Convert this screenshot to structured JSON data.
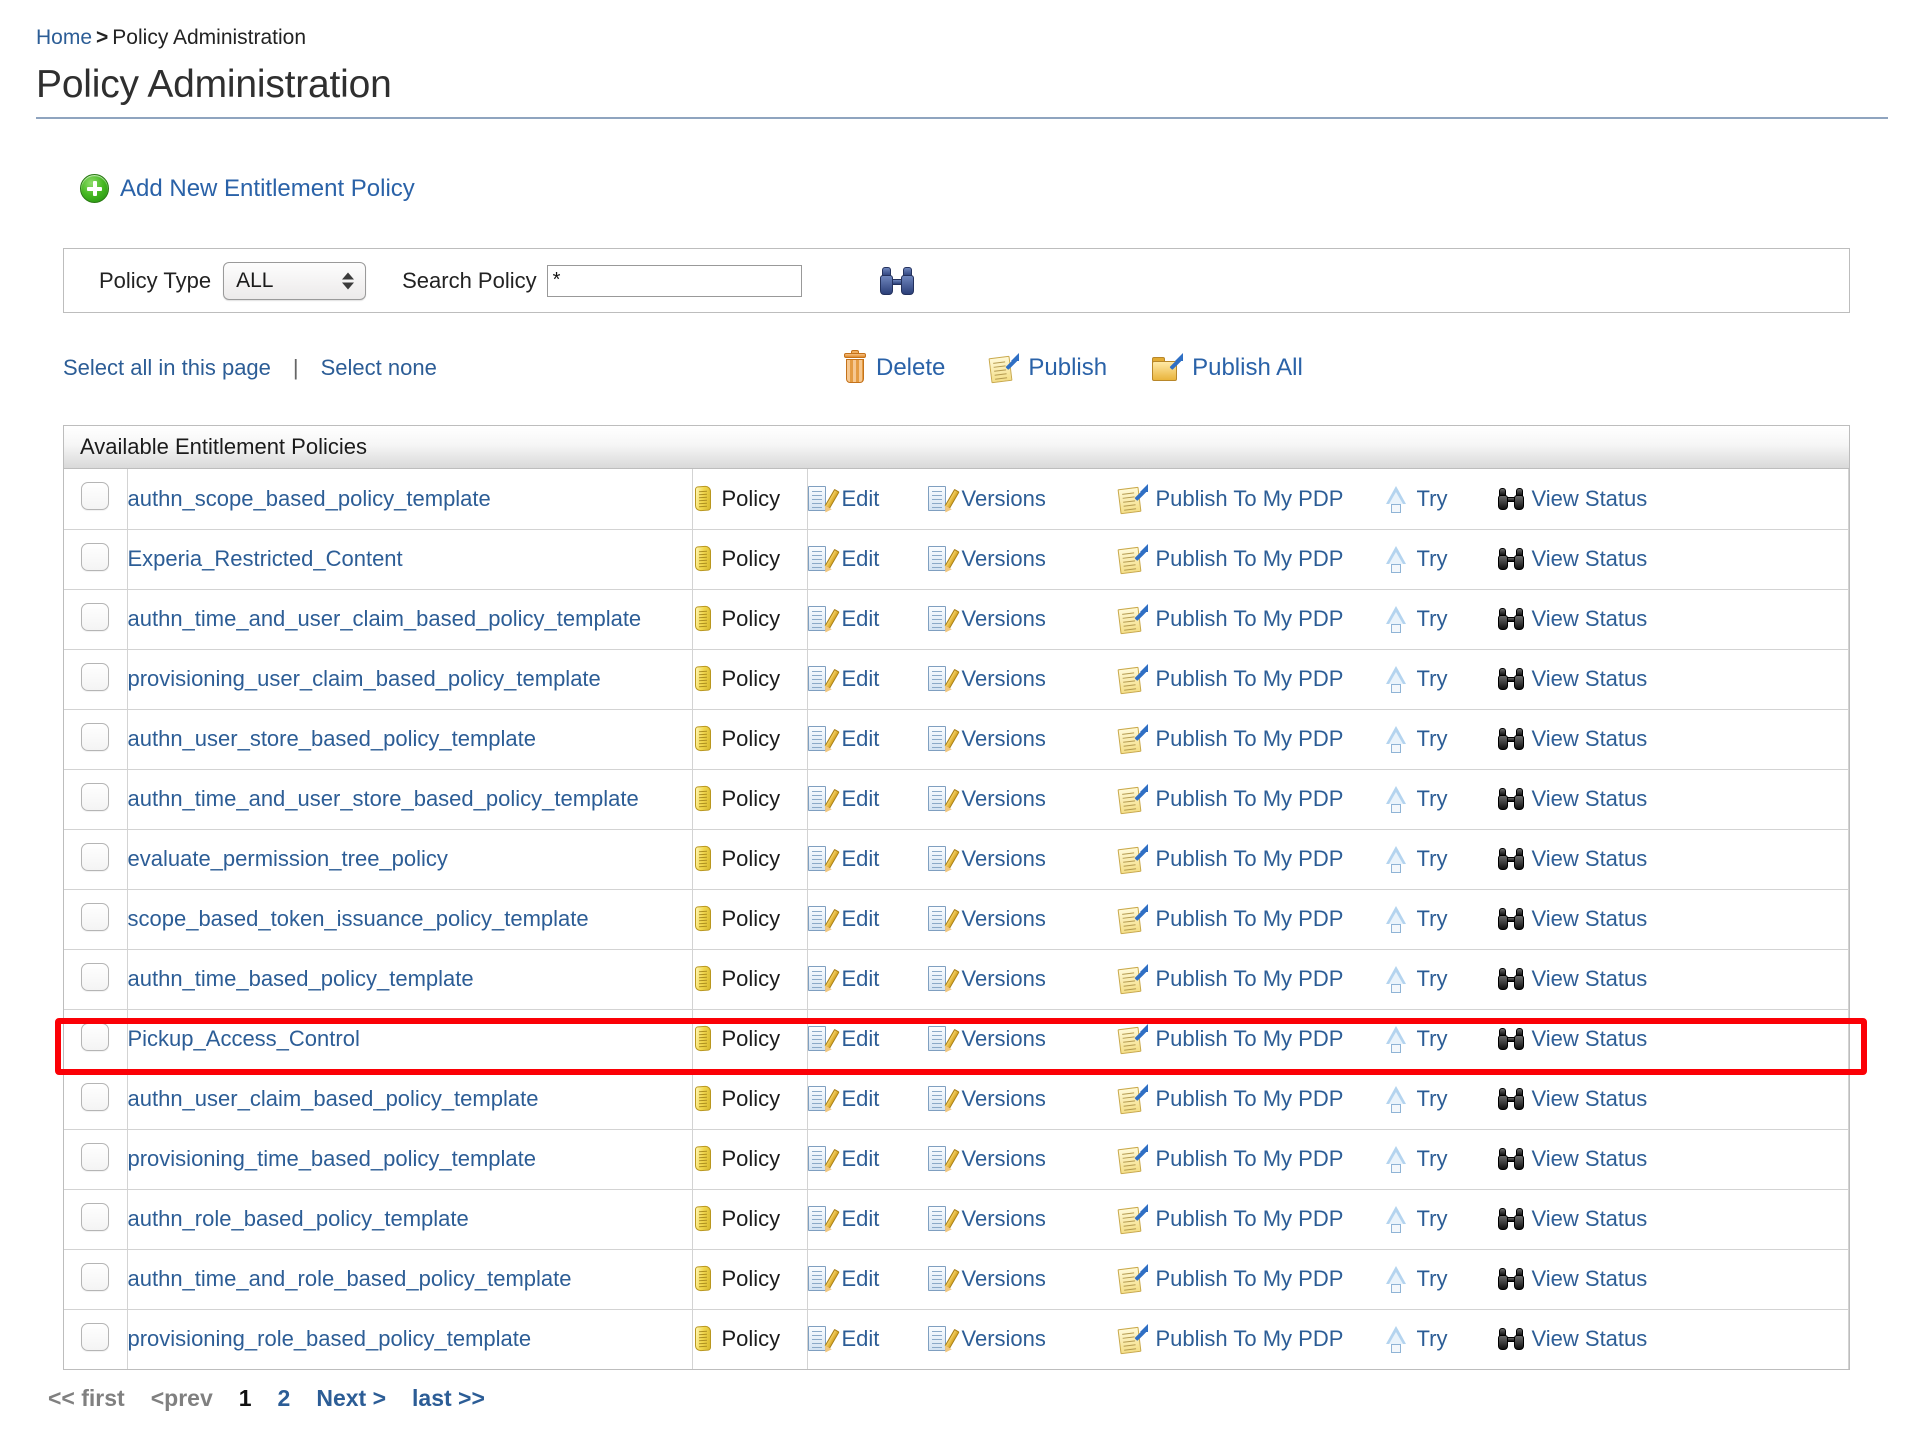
{
  "breadcrumb": {
    "home": "Home",
    "separator": ">",
    "current": "Policy Administration"
  },
  "page": {
    "title": "Policy Administration"
  },
  "add_new": {
    "label": "Add New Entitlement Policy",
    "icon": "plus-circle-icon"
  },
  "filter": {
    "policy_type_label": "Policy Type",
    "policy_type_value": "ALL",
    "search_label": "Search Policy",
    "search_value": "*",
    "search_placeholder": "",
    "search_icon": "binoculars-icon"
  },
  "selection": {
    "select_all": "Select all in this page",
    "pipe": "|",
    "select_none": "Select none"
  },
  "bulk_actions": [
    {
      "label": "Delete",
      "icon": "trash-icon"
    },
    {
      "label": "Publish",
      "icon": "publish-icon"
    },
    {
      "label": "Publish All",
      "icon": "publish-all-icon"
    }
  ],
  "table": {
    "caption": "Available Entitlement Policies",
    "type_label": "Policy",
    "type_icon": "scroll-icon",
    "row_actions": [
      {
        "label": "Edit",
        "icon": "edit-icon"
      },
      {
        "label": "Versions",
        "icon": "versions-icon"
      },
      {
        "label": "Publish To My PDP",
        "icon": "publish-icon"
      },
      {
        "label": "Try",
        "icon": "try-icon"
      },
      {
        "label": "View Status",
        "icon": "binoculars-icon"
      }
    ],
    "rows": [
      {
        "name": "authn_scope_based_policy_template",
        "checked": false,
        "highlighted": false
      },
      {
        "name": "Experia_Restricted_Content",
        "checked": false,
        "highlighted": false
      },
      {
        "name": "authn_time_and_user_claim_based_policy_template",
        "checked": false,
        "highlighted": false
      },
      {
        "name": "provisioning_user_claim_based_policy_template",
        "checked": false,
        "highlighted": false
      },
      {
        "name": "authn_user_store_based_policy_template",
        "checked": false,
        "highlighted": false
      },
      {
        "name": "authn_time_and_user_store_based_policy_template",
        "checked": false,
        "highlighted": false
      },
      {
        "name": "evaluate_permission_tree_policy",
        "checked": false,
        "highlighted": false
      },
      {
        "name": "scope_based_token_issuance_policy_template",
        "checked": false,
        "highlighted": false
      },
      {
        "name": "authn_time_based_policy_template",
        "checked": false,
        "highlighted": false
      },
      {
        "name": "Pickup_Access_Control",
        "checked": false,
        "highlighted": true
      },
      {
        "name": "authn_user_claim_based_policy_template",
        "checked": false,
        "highlighted": false
      },
      {
        "name": "provisioning_time_based_policy_template",
        "checked": false,
        "highlighted": false
      },
      {
        "name": "authn_role_based_policy_template",
        "checked": false,
        "highlighted": false
      },
      {
        "name": "authn_time_and_role_based_policy_template",
        "checked": false,
        "highlighted": false
      },
      {
        "name": "provisioning_role_based_policy_template",
        "checked": false,
        "highlighted": false
      }
    ]
  },
  "pagination": {
    "first": "<< first",
    "prev": "<prev",
    "page_1": "1",
    "page_2": "2",
    "next": "Next >",
    "last": "last >>",
    "current_page": "1"
  },
  "colors": {
    "link": "#2c5d96",
    "highlight": "#fb0006",
    "rule": "#8fa4bf",
    "border": "#bdbdbd"
  }
}
